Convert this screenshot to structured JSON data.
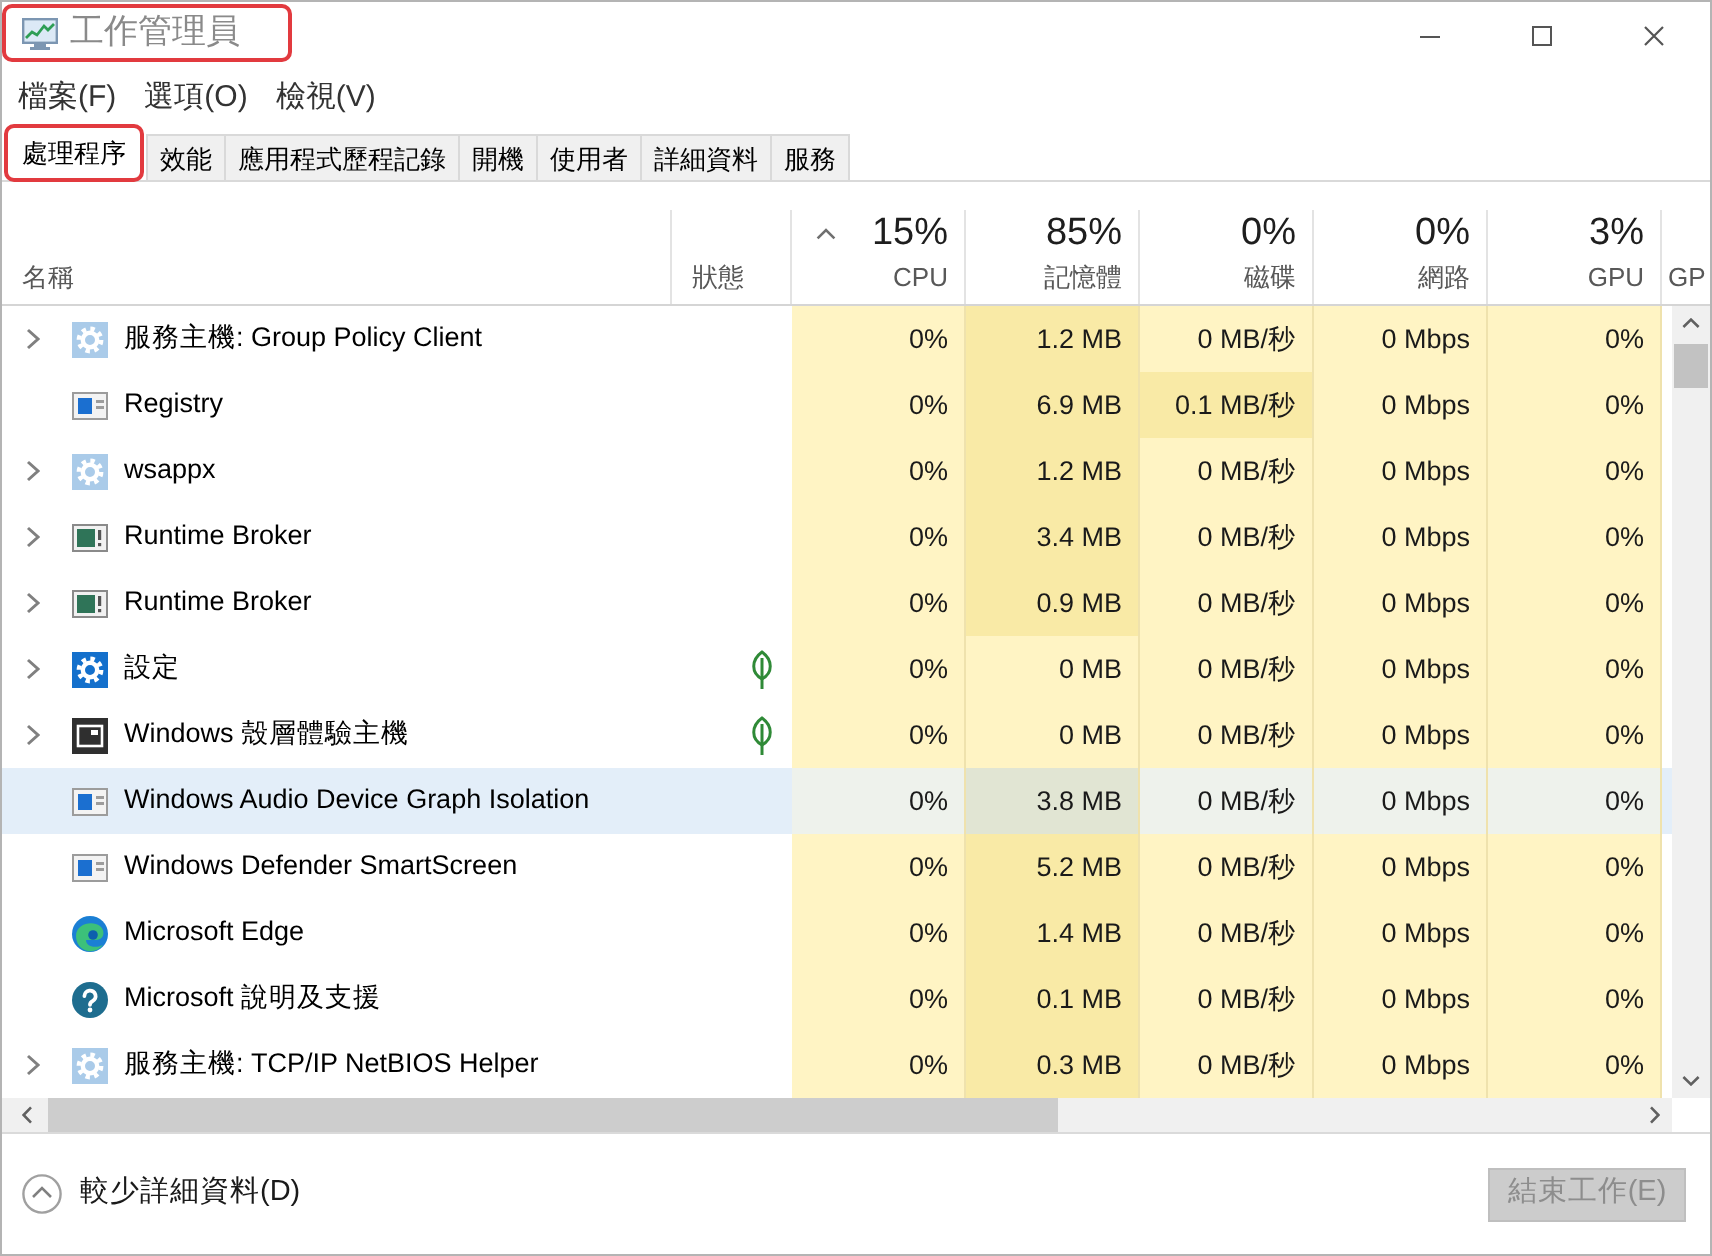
{
  "window": {
    "title": "工作管理員",
    "highlighted": true
  },
  "menu": [
    "檔案(F)",
    "選項(O)",
    "檢視(V)"
  ],
  "tabs": [
    {
      "label": "處理程序",
      "selected": true,
      "highlighted": true
    },
    {
      "label": "效能",
      "selected": false,
      "highlighted": false
    },
    {
      "label": "應用程式歷程記錄",
      "selected": false,
      "highlighted": false
    },
    {
      "label": "開機",
      "selected": false,
      "highlighted": false
    },
    {
      "label": "使用者",
      "selected": false,
      "highlighted": false
    },
    {
      "label": "詳細資料",
      "selected": false,
      "highlighted": false
    },
    {
      "label": "服務",
      "selected": false,
      "highlighted": false
    }
  ],
  "columns": [
    {
      "label": "名稱",
      "sorted": false
    },
    {
      "label": "狀態",
      "sorted": false
    },
    {
      "usage": "15%",
      "label": "CPU",
      "sorted": true
    },
    {
      "usage": "85%",
      "label": "記憶體",
      "sorted": false
    },
    {
      "usage": "0%",
      "label": "磁碟",
      "sorted": false
    },
    {
      "usage": "0%",
      "label": "網路",
      "sorted": false
    },
    {
      "usage": "3%",
      "label": "GPU",
      "sorted": false
    },
    {
      "label": "GP",
      "sorted": false
    }
  ],
  "rows": [
    {
      "kind": "service",
      "name": "服務主機: Group Policy Client",
      "expandable": true,
      "suspended": false,
      "selected": false,
      "cells": [
        {
          "value": "0%",
          "busy": false
        },
        {
          "value": "1.2 MB",
          "busy": true
        },
        {
          "value": "0 MB/秒",
          "busy": false
        },
        {
          "value": "0 Mbps",
          "busy": false
        },
        {
          "value": "0%",
          "busy": false
        }
      ]
    },
    {
      "kind": "system",
      "name": "Registry",
      "expandable": false,
      "suspended": false,
      "selected": false,
      "cells": [
        {
          "value": "0%",
          "busy": false
        },
        {
          "value": "6.9 MB",
          "busy": true
        },
        {
          "value": "0.1 MB/秒",
          "busy": true
        },
        {
          "value": "0 Mbps",
          "busy": false
        },
        {
          "value": "0%",
          "busy": false
        }
      ]
    },
    {
      "kind": "service",
      "name": "wsappx",
      "expandable": true,
      "suspended": false,
      "selected": false,
      "cells": [
        {
          "value": "0%",
          "busy": false
        },
        {
          "value": "1.2 MB",
          "busy": true
        },
        {
          "value": "0 MB/秒",
          "busy": false
        },
        {
          "value": "0 Mbps",
          "busy": false
        },
        {
          "value": "0%",
          "busy": false
        }
      ]
    },
    {
      "kind": "broker",
      "name": "Runtime Broker",
      "expandable": true,
      "suspended": false,
      "selected": false,
      "cells": [
        {
          "value": "0%",
          "busy": false
        },
        {
          "value": "3.4 MB",
          "busy": true
        },
        {
          "value": "0 MB/秒",
          "busy": false
        },
        {
          "value": "0 Mbps",
          "busy": false
        },
        {
          "value": "0%",
          "busy": false
        }
      ]
    },
    {
      "kind": "broker",
      "name": "Runtime Broker",
      "expandable": true,
      "suspended": false,
      "selected": false,
      "cells": [
        {
          "value": "0%",
          "busy": false
        },
        {
          "value": "0.9 MB",
          "busy": true
        },
        {
          "value": "0 MB/秒",
          "busy": false
        },
        {
          "value": "0 Mbps",
          "busy": false
        },
        {
          "value": "0%",
          "busy": false
        }
      ]
    },
    {
      "kind": "settings",
      "name": "設定",
      "expandable": true,
      "suspended": true,
      "selected": false,
      "cells": [
        {
          "value": "0%",
          "busy": false
        },
        {
          "value": "0 MB",
          "busy": false
        },
        {
          "value": "0 MB/秒",
          "busy": false
        },
        {
          "value": "0 Mbps",
          "busy": false
        },
        {
          "value": "0%",
          "busy": false
        }
      ]
    },
    {
      "kind": "shell",
      "name": "Windows 殼層體驗主機",
      "expandable": true,
      "suspended": true,
      "selected": false,
      "cells": [
        {
          "value": "0%",
          "busy": false
        },
        {
          "value": "0 MB",
          "busy": false
        },
        {
          "value": "0 MB/秒",
          "busy": false
        },
        {
          "value": "0 Mbps",
          "busy": false
        },
        {
          "value": "0%",
          "busy": false
        }
      ]
    },
    {
      "kind": "system",
      "name": "Windows Audio Device Graph Isolation",
      "expandable": false,
      "suspended": false,
      "selected": true,
      "cells": [
        {
          "value": "0%",
          "busy": false
        },
        {
          "value": "3.8 MB",
          "busy": true
        },
        {
          "value": "0 MB/秒",
          "busy": false
        },
        {
          "value": "0 Mbps",
          "busy": false
        },
        {
          "value": "0%",
          "busy": false
        }
      ]
    },
    {
      "kind": "system",
      "name": "Windows Defender SmartScreen",
      "expandable": false,
      "suspended": false,
      "selected": false,
      "cells": [
        {
          "value": "0%",
          "busy": false
        },
        {
          "value": "5.2 MB",
          "busy": true
        },
        {
          "value": "0 MB/秒",
          "busy": false
        },
        {
          "value": "0 Mbps",
          "busy": false
        },
        {
          "value": "0%",
          "busy": false
        }
      ]
    },
    {
      "kind": "browser",
      "name": "Microsoft Edge",
      "expandable": false,
      "suspended": false,
      "selected": false,
      "cells": [
        {
          "value": "0%",
          "busy": false
        },
        {
          "value": "1.4 MB",
          "busy": true
        },
        {
          "value": "0 MB/秒",
          "busy": false
        },
        {
          "value": "0 Mbps",
          "busy": false
        },
        {
          "value": "0%",
          "busy": false
        }
      ]
    },
    {
      "kind": "help",
      "name": "Microsoft 說明及支援",
      "expandable": false,
      "suspended": false,
      "selected": false,
      "cells": [
        {
          "value": "0%",
          "busy": false
        },
        {
          "value": "0.1 MB",
          "busy": true
        },
        {
          "value": "0 MB/秒",
          "busy": false
        },
        {
          "value": "0 Mbps",
          "busy": false
        },
        {
          "value": "0%",
          "busy": false
        }
      ]
    },
    {
      "kind": "service",
      "name": "服務主機: TCP/IP NetBIOS Helper",
      "expandable": true,
      "suspended": false,
      "selected": false,
      "cells": [
        {
          "value": "0%",
          "busy": false
        },
        {
          "value": "0.3 MB",
          "busy": true
        },
        {
          "value": "0 MB/秒",
          "busy": false
        },
        {
          "value": "0 Mbps",
          "busy": false
        },
        {
          "value": "0%",
          "busy": false
        }
      ]
    }
  ],
  "footer": {
    "details_toggle": "較少詳細資料(D)",
    "end_task": {
      "label": "結束工作(E)",
      "disabled": true
    }
  }
}
